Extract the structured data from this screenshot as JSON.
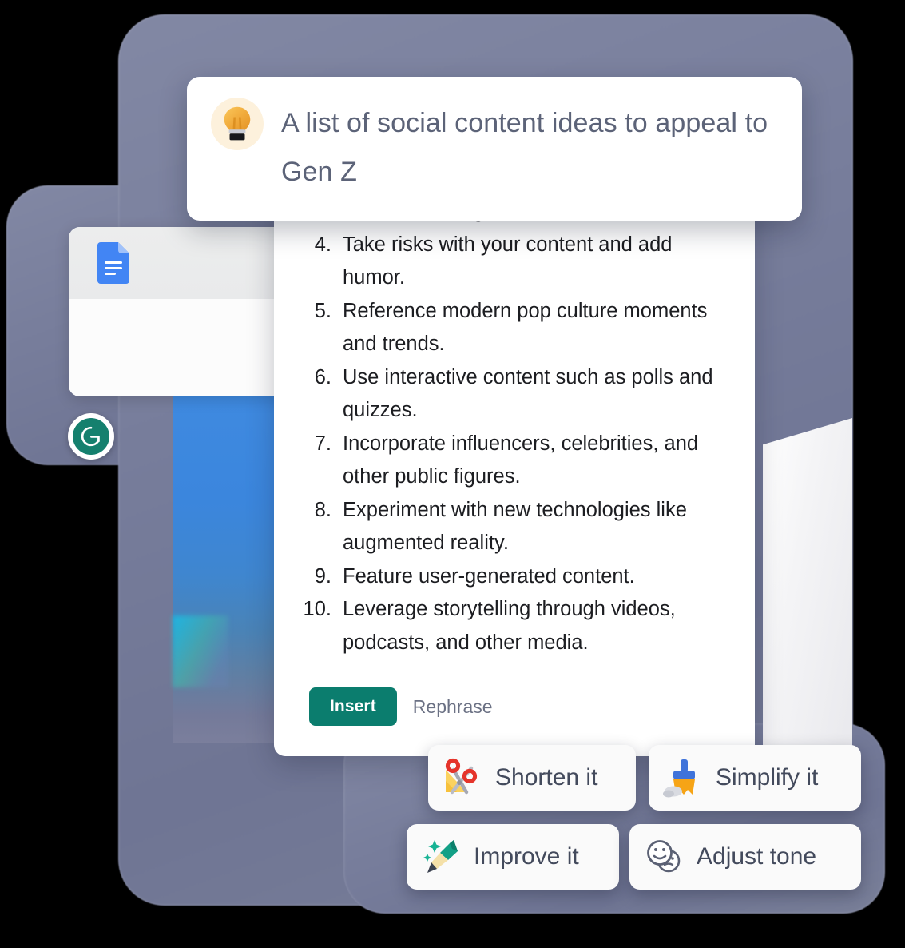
{
  "colors": {
    "background": "#000000",
    "slate_panel": "#7a8099",
    "card_white": "#ffffff",
    "insert_green": "#0b7d6e",
    "grammarly_green": "#15806e",
    "prompt_text": "#5c6378",
    "list_text": "#1c1d21",
    "rephrase_gray": "#6b7184",
    "chip_label": "#434a5c",
    "bulb_bg": "#fdf1dc",
    "docs_blue": "#4285f4",
    "photo_blue": "#3f8ae0"
  },
  "prompt": {
    "icon": "lightbulb-icon",
    "text": "A list of social content ideas to appeal to Gen Z"
  },
  "assistant_card": {
    "list_start_number": 3,
    "items": [
      "Use GIFs, images, and videos.",
      "Take risks with your content and add humor.",
      "Reference modern pop culture moments and trends.",
      "Use interactive content such as polls and quizzes.",
      "Incorporate influencers, celebrities, and other public figures.",
      "Experiment with new technologies like augmented reality.",
      "Feature user-generated content.",
      "Leverage storytelling through videos, podcasts, and other media."
    ],
    "actions": {
      "insert_label": "Insert",
      "rephrase_label": "Rephrase"
    }
  },
  "suggestion_chips": [
    {
      "label": "Shorten it",
      "icon": "scissors-icon"
    },
    {
      "label": "Simplify it",
      "icon": "broom-icon"
    },
    {
      "label": "Improve it",
      "icon": "sparkle-pencil-icon"
    },
    {
      "label": "Adjust tone",
      "icon": "smiley-faces-icon"
    }
  ],
  "background_app": {
    "docs_window_icon": "google-docs-icon",
    "grammarly_badge_icon": "grammarly-logo-icon"
  }
}
